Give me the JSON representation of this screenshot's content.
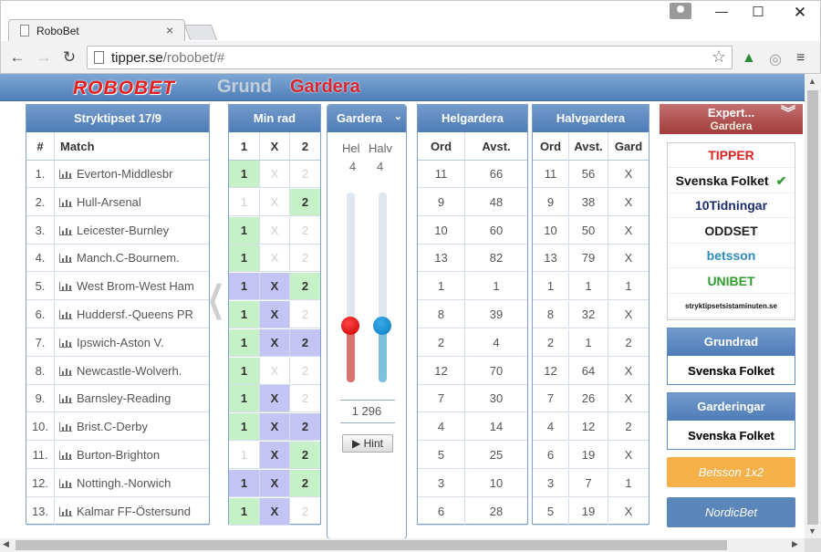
{
  "browser": {
    "tab_title": "RoboBet",
    "url_host": "tipper.se",
    "url_path": "/robobet/#"
  },
  "header": {
    "logo": "ROBOBET",
    "nav_grund": "Grund",
    "nav_gardera": "Gardera"
  },
  "stryktipset": {
    "title": "Stryktipset 17/9",
    "col_num": "#",
    "col_match": "Match",
    "rows": [
      {
        "n": "1.",
        "match": "Everton-Middlesbr"
      },
      {
        "n": "2.",
        "match": "Hull-Arsenal"
      },
      {
        "n": "3.",
        "match": "Leicester-Burnley"
      },
      {
        "n": "4.",
        "match": "Manch.C-Bournem."
      },
      {
        "n": "5.",
        "match": "West Brom-West Ham"
      },
      {
        "n": "6.",
        "match": "Huddersf.-Queens PR"
      },
      {
        "n": "7.",
        "match": "Ipswich-Aston V."
      },
      {
        "n": "8.",
        "match": "Newcastle-Wolverh."
      },
      {
        "n": "9.",
        "match": "Barnsley-Reading"
      },
      {
        "n": "10.",
        "match": "Brist.C-Derby"
      },
      {
        "n": "11.",
        "match": "Burton-Brighton"
      },
      {
        "n": "12.",
        "match": "Nottingh.-Norwich"
      },
      {
        "n": "13.",
        "match": "Kalmar FF-Östersund"
      }
    ]
  },
  "minrad": {
    "title": "Min rad",
    "cols": [
      "1",
      "X",
      "2"
    ],
    "rows": [
      [
        "g",
        "d",
        "d"
      ],
      [
        "d",
        "d",
        "g"
      ],
      [
        "g",
        "d",
        "d"
      ],
      [
        "g",
        "d",
        "d"
      ],
      [
        "p",
        "p",
        "g"
      ],
      [
        "g",
        "p",
        "d"
      ],
      [
        "g",
        "p",
        "p"
      ],
      [
        "g",
        "d",
        "d"
      ],
      [
        "g",
        "p",
        "d"
      ],
      [
        "g",
        "p",
        "p"
      ],
      [
        "d",
        "p",
        "g"
      ],
      [
        "p",
        "p",
        "g"
      ],
      [
        "g",
        "p",
        "d"
      ]
    ]
  },
  "gardera": {
    "title": "Gardera",
    "hel_label": "Hel",
    "halv_label": "Halv",
    "hel_value": "4",
    "halv_value": "4",
    "hel_level": 0.3,
    "halv_level": 0.3,
    "total": "1 296",
    "hint": "Hint"
  },
  "helgardera": {
    "title": "Helgardera",
    "col_ord": "Ord",
    "col_avst": "Avst.",
    "rows": [
      [
        "11",
        "66"
      ],
      [
        "9",
        "48"
      ],
      [
        "10",
        "60"
      ],
      [
        "13",
        "82"
      ],
      [
        "1",
        "1"
      ],
      [
        "8",
        "39"
      ],
      [
        "2",
        "4"
      ],
      [
        "12",
        "70"
      ],
      [
        "7",
        "30"
      ],
      [
        "4",
        "14"
      ],
      [
        "5",
        "25"
      ],
      [
        "3",
        "10"
      ],
      [
        "6",
        "28"
      ]
    ]
  },
  "halvgardera": {
    "title": "Halvgardera",
    "col_ord": "Ord",
    "col_avst": "Avst.",
    "col_gard": "Gard",
    "rows": [
      [
        "11",
        "56",
        "X"
      ],
      [
        "9",
        "38",
        "X"
      ],
      [
        "10",
        "50",
        "X"
      ],
      [
        "13",
        "79",
        "X"
      ],
      [
        "1",
        "1",
        "1"
      ],
      [
        "8",
        "32",
        "X"
      ],
      [
        "2",
        "1",
        "2"
      ],
      [
        "12",
        "64",
        "X"
      ],
      [
        "7",
        "26",
        "X"
      ],
      [
        "4",
        "12",
        "2"
      ],
      [
        "6",
        "19",
        "X"
      ],
      [
        "3",
        "7",
        "1"
      ],
      [
        "5",
        "19",
        "X"
      ]
    ]
  },
  "sidebar": {
    "expert_title": "Expert...",
    "expert_sub": "Gardera",
    "sources": [
      {
        "name": "TIPPER",
        "color": "#e02020"
      },
      {
        "name": "Svenska Folket",
        "color": "#111111",
        "check": "✔"
      },
      {
        "name": "10Tidningar",
        "color": "#1c2c6c"
      },
      {
        "name": "ODDSET",
        "color": "#222222"
      },
      {
        "name": "betsson",
        "color": "#2b8bbf"
      },
      {
        "name": "UNIBET",
        "color": "#2f9e2f"
      },
      {
        "name": "stryktipsetsistaminuten.se",
        "color": "#111111"
      }
    ],
    "grundrad_title": "Grundrad",
    "grundrad_value": "Svenska Folket",
    "garderingar_title": "Garderingar",
    "garderingar_value": "Svenska Folket",
    "betsson_button": "Betsson 1x2",
    "nordicbet_button": "NordicBet"
  },
  "colors": {
    "green_cell": "#c6f0c6",
    "purple_cell": "#c4c4f4",
    "header_blue": "#4e7cb6",
    "expert_red": "#a33c3c",
    "betsson_orange": "#f5b04a",
    "nordicbet_blue": "#5a86ba"
  }
}
